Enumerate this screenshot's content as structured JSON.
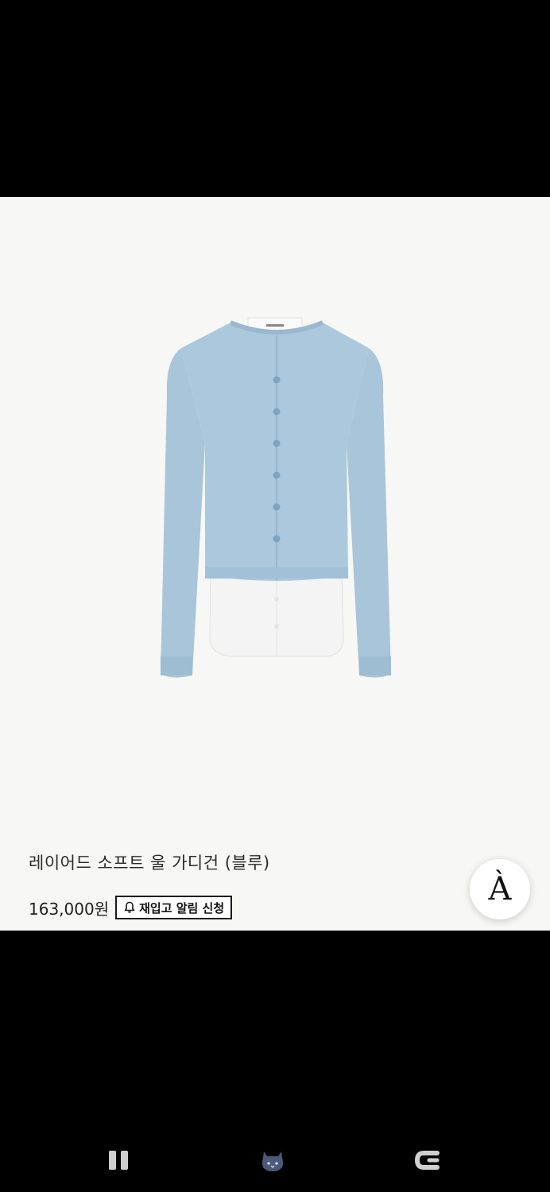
{
  "product": {
    "name": "레이어드 소프트 울 가디건 (블루)",
    "price": "163,000원",
    "restock_label": "재입고 알림 신청",
    "image_label": "Layered soft wool cardigan, blue, with white shirt layer"
  },
  "accessibility": {
    "glyph": "À"
  },
  "nav": {
    "recents_icon": "recents-icon",
    "home_icon": "home-character-icon",
    "back_icon": "back-icon"
  },
  "colors": {
    "background": "#f7f7f5",
    "cardigan": "#a9c5d9",
    "shirt": "#f4f4f4",
    "text": "#2b2b2b"
  }
}
